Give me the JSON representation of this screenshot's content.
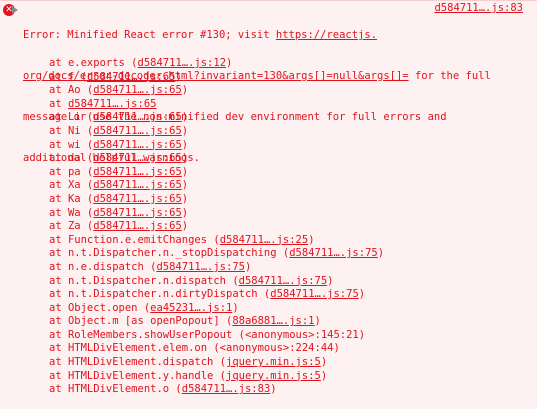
{
  "error": {
    "icon": "error-x-icon",
    "expand_icon": "disclosure-triangle-icon",
    "line1_prefix": "Error: Minified React error #130; visit ",
    "line1_link": "https://reactjs.",
    "source_link": "d584711….js:83",
    "line2_link": "org/docs/error-decoder.html?invariant=130&args[]=null&args[]=",
    "line2_suffix": " for the full",
    "line3": "message or use the non-minified dev environment for full errors and",
    "line4": "additional helpful warnings."
  },
  "stack": [
    {
      "prefix": "at e.exports (",
      "link": "d584711….js:12",
      "suffix": ")"
    },
    {
      "prefix": "at f (",
      "link": "d584711….js:65",
      "suffix": ")"
    },
    {
      "prefix": "at Ao (",
      "link": "d584711….js:65",
      "suffix": ")"
    },
    {
      "prefix": "at ",
      "link": "d584711….js:65",
      "suffix": ""
    },
    {
      "prefix": "at Li (",
      "link": "d584711….js:65",
      "suffix": ")"
    },
    {
      "prefix": "at Ni (",
      "link": "d584711….js:65",
      "suffix": ")"
    },
    {
      "prefix": "at wi (",
      "link": "d584711….js:65",
      "suffix": ")"
    },
    {
      "prefix": "at da (",
      "link": "d584711….js:65",
      "suffix": ")"
    },
    {
      "prefix": "at pa (",
      "link": "d584711….js:65",
      "suffix": ")"
    },
    {
      "prefix": "at Xa (",
      "link": "d584711….js:65",
      "suffix": ")"
    },
    {
      "prefix": "at Ka (",
      "link": "d584711….js:65",
      "suffix": ")"
    },
    {
      "prefix": "at Wa (",
      "link": "d584711….js:65",
      "suffix": ")"
    },
    {
      "prefix": "at Za (",
      "link": "d584711….js:65",
      "suffix": ")"
    },
    {
      "prefix": "at Function.e.emitChanges (",
      "link": "d584711….js:25",
      "suffix": ")"
    },
    {
      "prefix": "at n.t.Dispatcher.n._stopDispatching (",
      "link": "d584711….js:75",
      "suffix": ")"
    },
    {
      "prefix": "at n.e.dispatch (",
      "link": "d584711….js:75",
      "suffix": ")"
    },
    {
      "prefix": "at n.t.Dispatcher.n.dispatch (",
      "link": "d584711….js:75",
      "suffix": ")"
    },
    {
      "prefix": "at n.t.Dispatcher.n.dirtyDispatch (",
      "link": "d584711….js:75",
      "suffix": ")"
    },
    {
      "prefix": "at Object.open (",
      "link": "ea45231….js:1",
      "suffix": ")"
    },
    {
      "prefix": "at Object.m [as openPopout] (",
      "link": "88a6881….js:1",
      "suffix": ")"
    },
    {
      "prefix": "at RoleMembers.showUserPopout (<anonymous>:145:21)",
      "link": "",
      "suffix": ""
    },
    {
      "prefix": "at HTMLDivElement.elem.on (<anonymous>:224:44)",
      "link": "",
      "suffix": ""
    },
    {
      "prefix": "at HTMLDivElement.dispatch (",
      "link": "jquery.min.js:5",
      "suffix": ")"
    },
    {
      "prefix": "at HTMLDivElement.y.handle (",
      "link": "jquery.min.js:5",
      "suffix": ")"
    },
    {
      "prefix": "at HTMLDivElement.o (",
      "link": "d584711….js:83",
      "suffix": ")"
    }
  ]
}
